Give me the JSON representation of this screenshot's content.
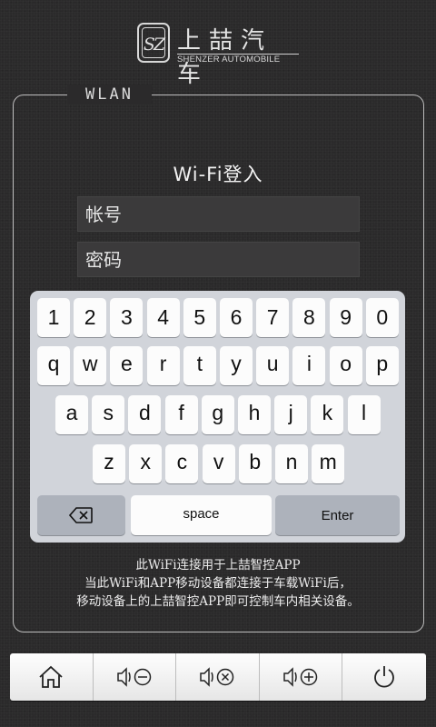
{
  "logo": {
    "cn": "上喆汽车",
    "en": "SHENZER AUTOMOBILE",
    "badge": "SZ"
  },
  "panel": {
    "legend": "WLAN",
    "title": "Wi-Fi登入"
  },
  "form": {
    "account_value": "帐号",
    "password_value": "密码"
  },
  "keyboard": {
    "row1": [
      "1",
      "2",
      "3",
      "4",
      "5",
      "6",
      "7",
      "8",
      "9",
      "0"
    ],
    "row2": [
      "q",
      "w",
      "e",
      "r",
      "t",
      "y",
      "u",
      "i",
      "o",
      "p"
    ],
    "row3": [
      "a",
      "s",
      "d",
      "f",
      "g",
      "h",
      "j",
      "k",
      "l"
    ],
    "row4": [
      "z",
      "x",
      "c",
      "v",
      "b",
      "n",
      "m"
    ],
    "space_label": "space",
    "enter_label": "Enter",
    "backspace_icon": "backspace-icon"
  },
  "info": [
    "此WiFi连接用于上喆智控APP",
    "当此WiFi和APP移动设备都连接于车载WiFi后，",
    "移动设备上的上喆智控APP即可控制车内相关设备。"
  ],
  "bottom_bar": [
    {
      "icon": "home-icon"
    },
    {
      "icon": "volume-down-icon"
    },
    {
      "icon": "mute-icon"
    },
    {
      "icon": "volume-up-icon"
    },
    {
      "icon": "power-icon"
    }
  ]
}
